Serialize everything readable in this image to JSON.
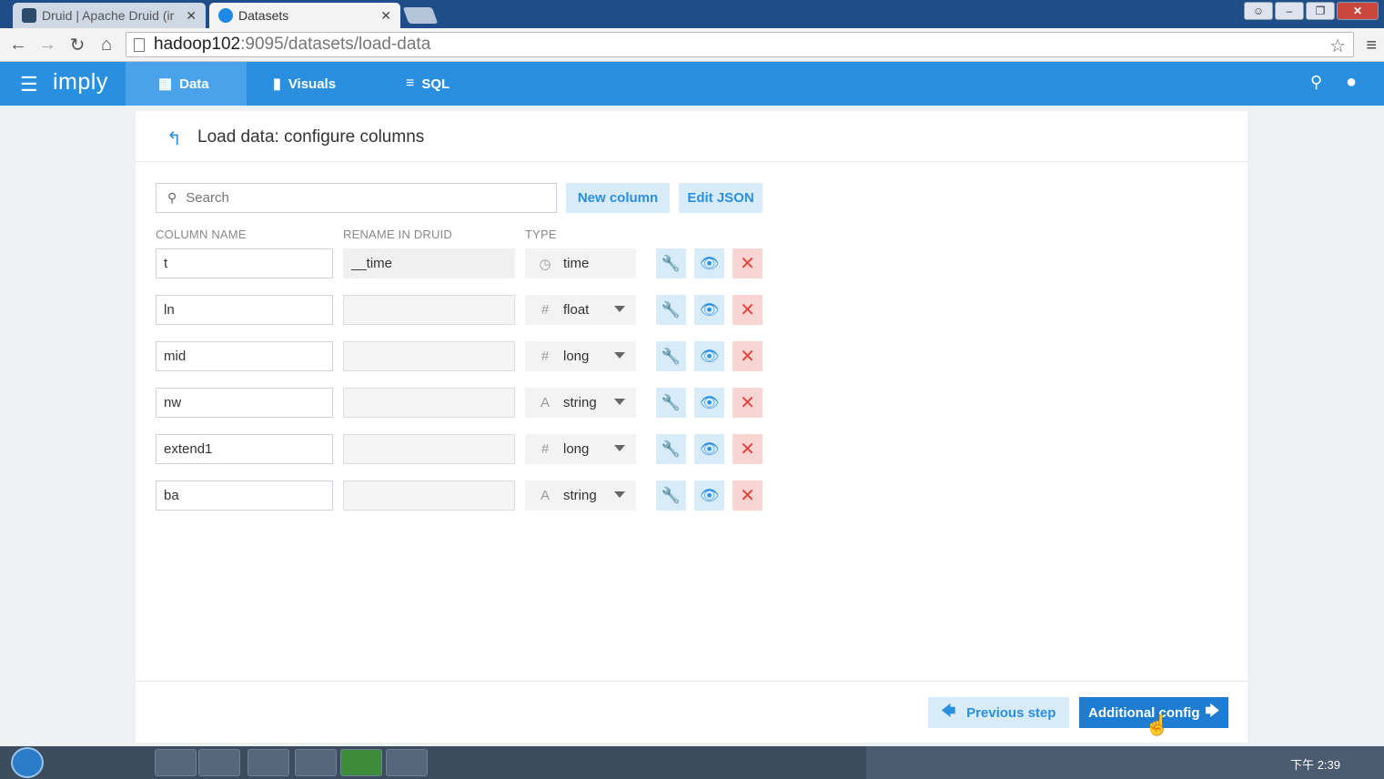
{
  "browser": {
    "tabs": [
      {
        "title": "Druid | Apache Druid (ir",
        "close": "✕",
        "active": false
      },
      {
        "title": "Datasets",
        "close": "✕",
        "active": true
      }
    ],
    "url_host": "hadoop102",
    "url_rest": ":9095/datasets/load-data"
  },
  "app": {
    "logo": "imply",
    "nav": [
      {
        "label": "Data",
        "active": true
      },
      {
        "label": "Visuals",
        "active": false
      },
      {
        "label": "SQL",
        "active": false
      }
    ]
  },
  "page": {
    "title": "Load data: configure columns",
    "search_placeholder": "Search",
    "new_column_label": "New column",
    "edit_json_label": "Edit JSON",
    "headers": {
      "column_name": "COLUMN NAME",
      "rename": "RENAME IN DRUID",
      "type": "TYPE"
    },
    "rows": [
      {
        "name": "t",
        "rename": "__time",
        "type": "time",
        "type_icon": "clock-icon",
        "has_dropdown": false
      },
      {
        "name": "ln",
        "rename": "",
        "type": "float",
        "type_icon": "hash-icon",
        "has_dropdown": true
      },
      {
        "name": "mid",
        "rename": "",
        "type": "long",
        "type_icon": "hash-icon",
        "has_dropdown": true
      },
      {
        "name": "nw",
        "rename": "",
        "type": "string",
        "type_icon": "text-icon",
        "has_dropdown": true
      },
      {
        "name": "extend1",
        "rename": "",
        "type": "long",
        "type_icon": "hash-icon",
        "has_dropdown": true
      },
      {
        "name": "ba",
        "rename": "",
        "type": "string",
        "type_icon": "text-icon",
        "has_dropdown": true
      }
    ],
    "previous_label": "Previous step",
    "next_label": "Additional config"
  },
  "taskbar": {
    "clock": "下午 2:39"
  },
  "colors": {
    "accent": "#2b8fe0",
    "primary_button": "#1e7dd0",
    "danger": "#e0453b"
  }
}
